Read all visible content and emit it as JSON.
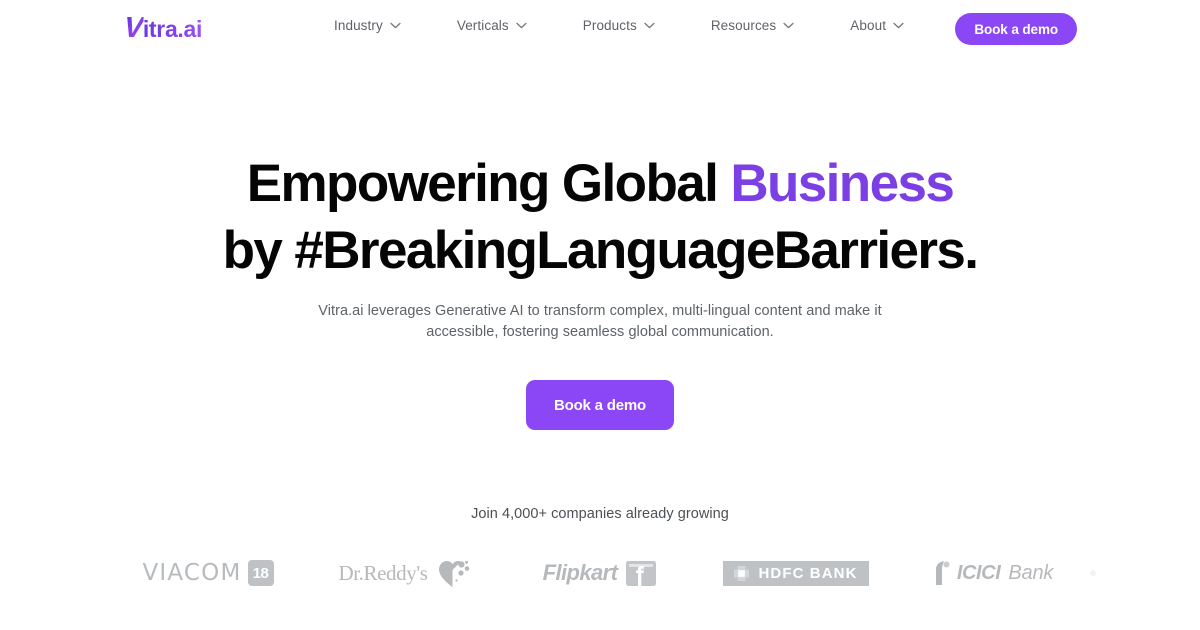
{
  "brand": {
    "logo_initial": "V",
    "logo_rest": "itra.ai",
    "accent_color": "#7B3FE4",
    "button_color": "#8B46F5"
  },
  "header": {
    "nav": [
      {
        "label": "Industry",
        "icon": "chevron-down-icon"
      },
      {
        "label": "Verticals",
        "icon": "chevron-down-icon"
      },
      {
        "label": "Products",
        "icon": "chevron-down-icon"
      },
      {
        "label": "Resources",
        "icon": "chevron-down-icon"
      },
      {
        "label": "About",
        "icon": "chevron-down-icon"
      }
    ],
    "cta_label": "Book a demo"
  },
  "hero": {
    "headline_line1_a": "Empowering Global ",
    "headline_line1_accent": "Business",
    "headline_line2": "by #BreakingLanguageBarriers.",
    "subtitle_line1": "Vitra.ai leverages Generative AI to transform complex, multi-lingual content and make it",
    "subtitle_line2": "accessible, fostering seamless global communication.",
    "cta_label": "Book a demo"
  },
  "social_proof": {
    "text": "Join 4,000+ companies already growing",
    "logos": [
      {
        "name": "viacom18",
        "word": "VIACOM",
        "badge": "18"
      },
      {
        "name": "dr-reddys",
        "word": "Dr.Reddy's"
      },
      {
        "name": "flipkart",
        "word": "Flipkart"
      },
      {
        "name": "hdfc-bank",
        "word": "HDFC BANK"
      },
      {
        "name": "icici-bank",
        "word_bold": "ICICI",
        "word_light": "Bank"
      }
    ]
  }
}
